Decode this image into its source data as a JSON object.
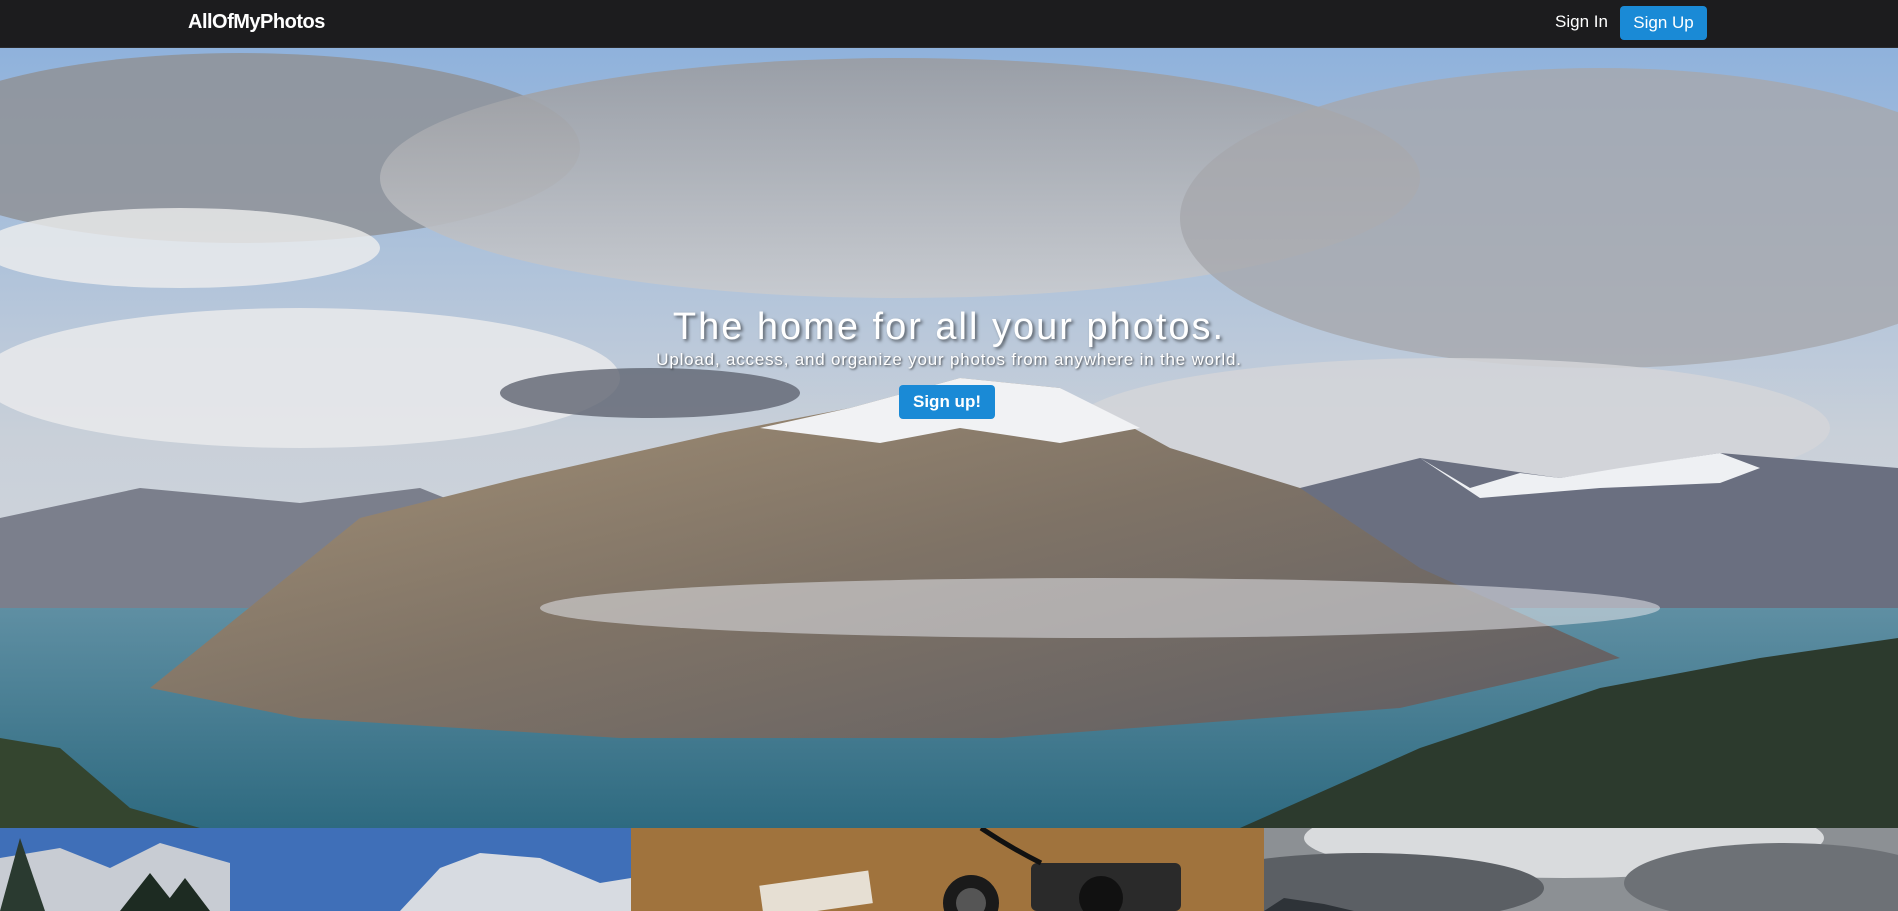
{
  "nav": {
    "brand": "AllOfMyPhotos",
    "sign_in": "Sign In",
    "sign_up": "Sign Up"
  },
  "hero": {
    "title": "The home for all your photos.",
    "subtitle": "Upload, access, and organize your photos from anywhere in the world.",
    "cta": "Sign up!",
    "image": "mountain-lake-landscape"
  },
  "gallery": {
    "tiles": [
      {
        "image": "snowy-peaks-forest"
      },
      {
        "image": "vintage-camera-on-map"
      },
      {
        "image": "stormy-clouds"
      }
    ]
  },
  "colors": {
    "navbar": "#1c1c1e",
    "accent": "#1a8ad6"
  }
}
